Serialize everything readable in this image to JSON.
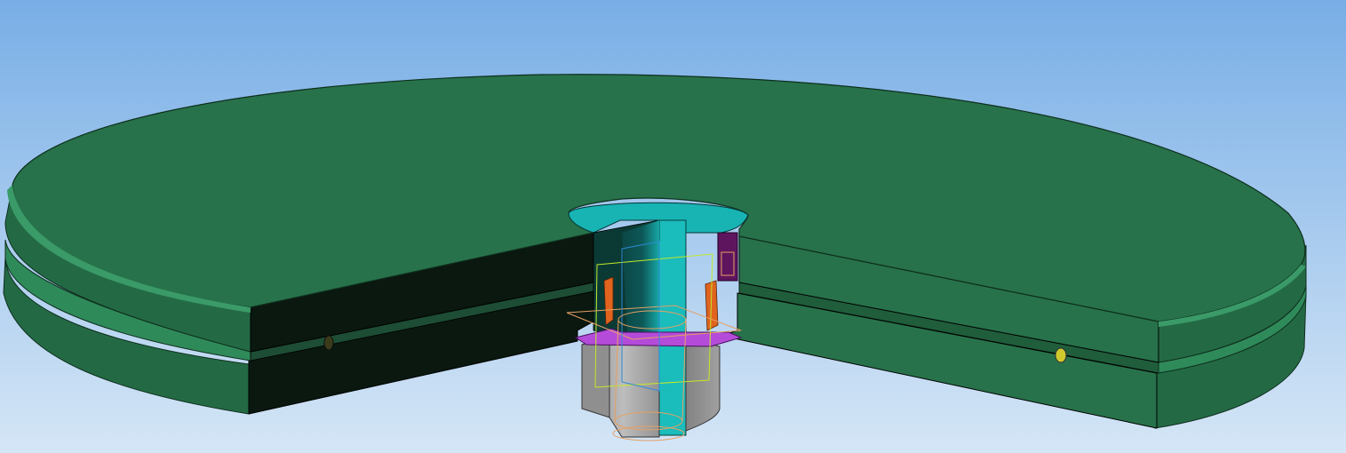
{
  "viewport": {
    "background_top": "#78aee6",
    "background_bottom": "#d5e6f6"
  },
  "model": {
    "disc_top_color": "#27724a",
    "disc_edge_color": "#2f8558",
    "disc_cut_face_color": "#0a1810",
    "bolt_cut_color": "#18b3b3",
    "bolt_dark_color": "#0c4c4c",
    "nut_color": "#a6a6a6",
    "washer_color": "#b44cd9",
    "sleeve_color": "#e0641e",
    "pin_color": "#5e155e",
    "wireframe_colors": [
      "#c2e82a",
      "#e6a063",
      "#2e8ad6"
    ],
    "dowel_color": "#cfc92e"
  }
}
